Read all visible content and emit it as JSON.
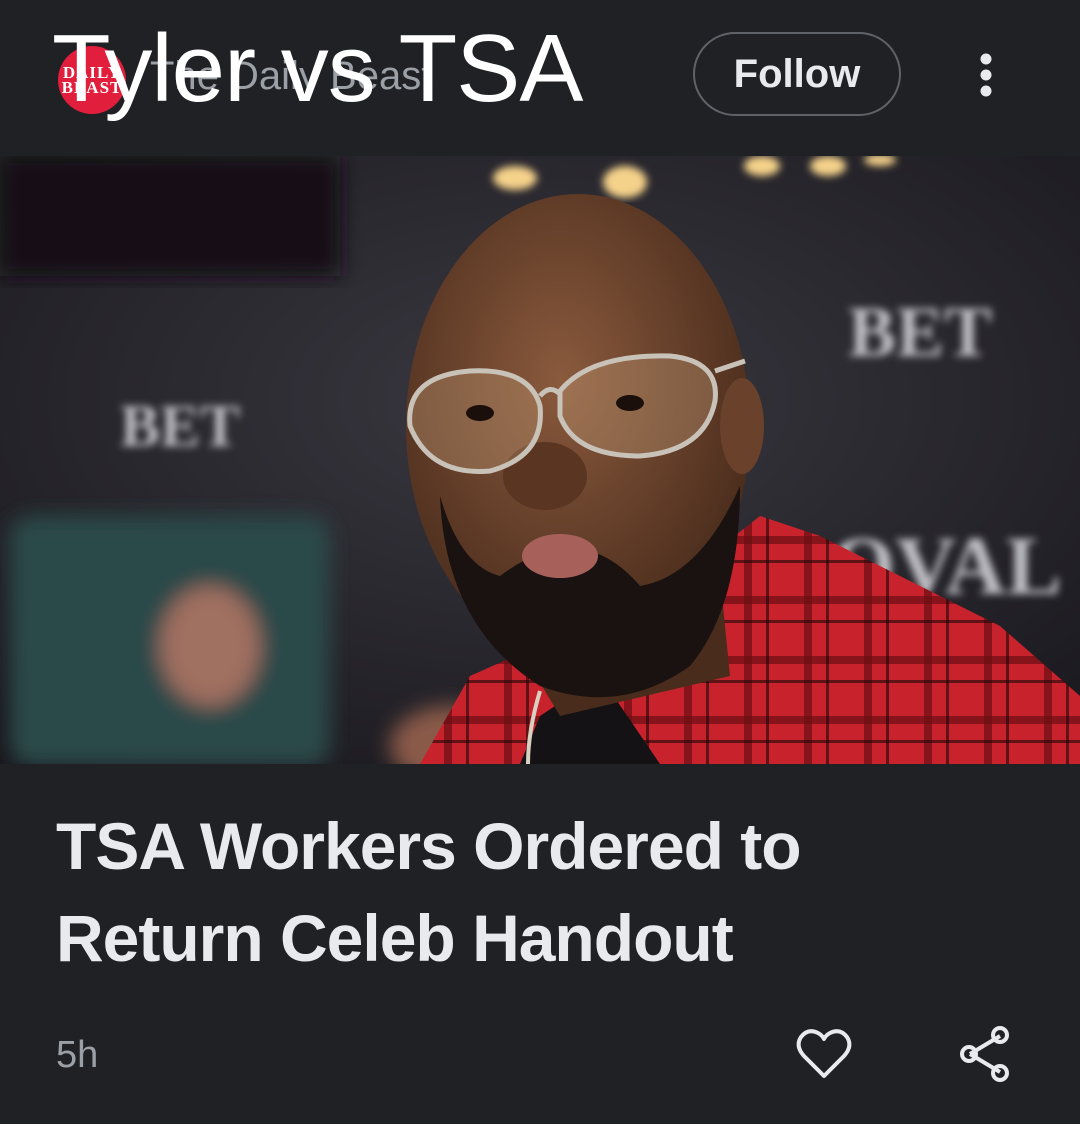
{
  "overlay_title": "Tyler vs TSA",
  "header": {
    "logo_text": "DAILY BEAST",
    "source_name": "The Daily Beast",
    "follow_label": "Follow",
    "more_icon": "more-vertical-icon"
  },
  "hero": {
    "backdrop_text_1": "BET",
    "backdrop_text_2": "BET",
    "backdrop_text_3": "OVAL",
    "shirt_color": "#c8232c"
  },
  "article": {
    "headline": "TSA Workers Ordered to Return Celeb Handout",
    "time": "5h",
    "like_icon": "heart-icon",
    "share_icon": "share-icon"
  }
}
